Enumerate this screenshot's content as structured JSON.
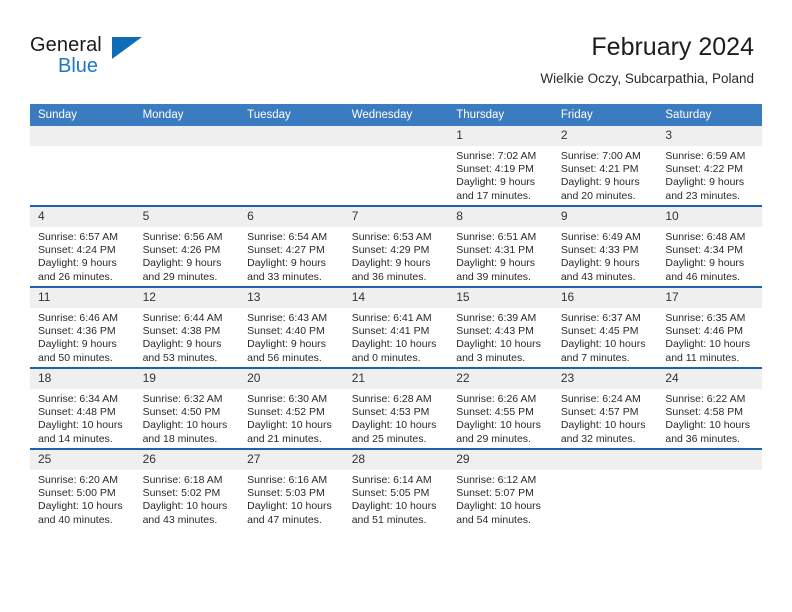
{
  "brand": {
    "name_top": "General",
    "name_bottom": "Blue",
    "accent_color": "#2077c4",
    "triangle_color": "#0d6cb5"
  },
  "header": {
    "title": "February 2024",
    "subtitle": "Wielkie Oczy, Subcarpathia, Poland"
  },
  "theme": {
    "header_bg": "#3b7cc1",
    "header_text": "#ffffff",
    "row_divider": "#1c63a8",
    "daynum_bg": "#efefef",
    "body_text": "#2a2a2a"
  },
  "calendar": {
    "weekday_headers": [
      "Sunday",
      "Monday",
      "Tuesday",
      "Wednesday",
      "Thursday",
      "Friday",
      "Saturday"
    ],
    "weeks": [
      [
        {
          "day": "",
          "empty": true
        },
        {
          "day": "",
          "empty": true
        },
        {
          "day": "",
          "empty": true
        },
        {
          "day": "",
          "empty": true
        },
        {
          "day": "1",
          "sunrise": "Sunrise: 7:02 AM",
          "sunset": "Sunset: 4:19 PM",
          "daylight_line1": "Daylight: 9 hours",
          "daylight_line2": "and 17 minutes."
        },
        {
          "day": "2",
          "sunrise": "Sunrise: 7:00 AM",
          "sunset": "Sunset: 4:21 PM",
          "daylight_line1": "Daylight: 9 hours",
          "daylight_line2": "and 20 minutes."
        },
        {
          "day": "3",
          "sunrise": "Sunrise: 6:59 AM",
          "sunset": "Sunset: 4:22 PM",
          "daylight_line1": "Daylight: 9 hours",
          "daylight_line2": "and 23 minutes."
        }
      ],
      [
        {
          "day": "4",
          "sunrise": "Sunrise: 6:57 AM",
          "sunset": "Sunset: 4:24 PM",
          "daylight_line1": "Daylight: 9 hours",
          "daylight_line2": "and 26 minutes."
        },
        {
          "day": "5",
          "sunrise": "Sunrise: 6:56 AM",
          "sunset": "Sunset: 4:26 PM",
          "daylight_line1": "Daylight: 9 hours",
          "daylight_line2": "and 29 minutes."
        },
        {
          "day": "6",
          "sunrise": "Sunrise: 6:54 AM",
          "sunset": "Sunset: 4:27 PM",
          "daylight_line1": "Daylight: 9 hours",
          "daylight_line2": "and 33 minutes."
        },
        {
          "day": "7",
          "sunrise": "Sunrise: 6:53 AM",
          "sunset": "Sunset: 4:29 PM",
          "daylight_line1": "Daylight: 9 hours",
          "daylight_line2": "and 36 minutes."
        },
        {
          "day": "8",
          "sunrise": "Sunrise: 6:51 AM",
          "sunset": "Sunset: 4:31 PM",
          "daylight_line1": "Daylight: 9 hours",
          "daylight_line2": "and 39 minutes."
        },
        {
          "day": "9",
          "sunrise": "Sunrise: 6:49 AM",
          "sunset": "Sunset: 4:33 PM",
          "daylight_line1": "Daylight: 9 hours",
          "daylight_line2": "and 43 minutes."
        },
        {
          "day": "10",
          "sunrise": "Sunrise: 6:48 AM",
          "sunset": "Sunset: 4:34 PM",
          "daylight_line1": "Daylight: 9 hours",
          "daylight_line2": "and 46 minutes."
        }
      ],
      [
        {
          "day": "11",
          "sunrise": "Sunrise: 6:46 AM",
          "sunset": "Sunset: 4:36 PM",
          "daylight_line1": "Daylight: 9 hours",
          "daylight_line2": "and 50 minutes."
        },
        {
          "day": "12",
          "sunrise": "Sunrise: 6:44 AM",
          "sunset": "Sunset: 4:38 PM",
          "daylight_line1": "Daylight: 9 hours",
          "daylight_line2": "and 53 minutes."
        },
        {
          "day": "13",
          "sunrise": "Sunrise: 6:43 AM",
          "sunset": "Sunset: 4:40 PM",
          "daylight_line1": "Daylight: 9 hours",
          "daylight_line2": "and 56 minutes."
        },
        {
          "day": "14",
          "sunrise": "Sunrise: 6:41 AM",
          "sunset": "Sunset: 4:41 PM",
          "daylight_line1": "Daylight: 10 hours",
          "daylight_line2": "and 0 minutes."
        },
        {
          "day": "15",
          "sunrise": "Sunrise: 6:39 AM",
          "sunset": "Sunset: 4:43 PM",
          "daylight_line1": "Daylight: 10 hours",
          "daylight_line2": "and 3 minutes."
        },
        {
          "day": "16",
          "sunrise": "Sunrise: 6:37 AM",
          "sunset": "Sunset: 4:45 PM",
          "daylight_line1": "Daylight: 10 hours",
          "daylight_line2": "and 7 minutes."
        },
        {
          "day": "17",
          "sunrise": "Sunrise: 6:35 AM",
          "sunset": "Sunset: 4:46 PM",
          "daylight_line1": "Daylight: 10 hours",
          "daylight_line2": "and 11 minutes."
        }
      ],
      [
        {
          "day": "18",
          "sunrise": "Sunrise: 6:34 AM",
          "sunset": "Sunset: 4:48 PM",
          "daylight_line1": "Daylight: 10 hours",
          "daylight_line2": "and 14 minutes."
        },
        {
          "day": "19",
          "sunrise": "Sunrise: 6:32 AM",
          "sunset": "Sunset: 4:50 PM",
          "daylight_line1": "Daylight: 10 hours",
          "daylight_line2": "and 18 minutes."
        },
        {
          "day": "20",
          "sunrise": "Sunrise: 6:30 AM",
          "sunset": "Sunset: 4:52 PM",
          "daylight_line1": "Daylight: 10 hours",
          "daylight_line2": "and 21 minutes."
        },
        {
          "day": "21",
          "sunrise": "Sunrise: 6:28 AM",
          "sunset": "Sunset: 4:53 PM",
          "daylight_line1": "Daylight: 10 hours",
          "daylight_line2": "and 25 minutes."
        },
        {
          "day": "22",
          "sunrise": "Sunrise: 6:26 AM",
          "sunset": "Sunset: 4:55 PM",
          "daylight_line1": "Daylight: 10 hours",
          "daylight_line2": "and 29 minutes."
        },
        {
          "day": "23",
          "sunrise": "Sunrise: 6:24 AM",
          "sunset": "Sunset: 4:57 PM",
          "daylight_line1": "Daylight: 10 hours",
          "daylight_line2": "and 32 minutes."
        },
        {
          "day": "24",
          "sunrise": "Sunrise: 6:22 AM",
          "sunset": "Sunset: 4:58 PM",
          "daylight_line1": "Daylight: 10 hours",
          "daylight_line2": "and 36 minutes."
        }
      ],
      [
        {
          "day": "25",
          "sunrise": "Sunrise: 6:20 AM",
          "sunset": "Sunset: 5:00 PM",
          "daylight_line1": "Daylight: 10 hours",
          "daylight_line2": "and 40 minutes."
        },
        {
          "day": "26",
          "sunrise": "Sunrise: 6:18 AM",
          "sunset": "Sunset: 5:02 PM",
          "daylight_line1": "Daylight: 10 hours",
          "daylight_line2": "and 43 minutes."
        },
        {
          "day": "27",
          "sunrise": "Sunrise: 6:16 AM",
          "sunset": "Sunset: 5:03 PM",
          "daylight_line1": "Daylight: 10 hours",
          "daylight_line2": "and 47 minutes."
        },
        {
          "day": "28",
          "sunrise": "Sunrise: 6:14 AM",
          "sunset": "Sunset: 5:05 PM",
          "daylight_line1": "Daylight: 10 hours",
          "daylight_line2": "and 51 minutes."
        },
        {
          "day": "29",
          "sunrise": "Sunrise: 6:12 AM",
          "sunset": "Sunset: 5:07 PM",
          "daylight_line1": "Daylight: 10 hours",
          "daylight_line2": "and 54 minutes."
        },
        {
          "day": "",
          "empty": true
        },
        {
          "day": "",
          "empty": true
        }
      ]
    ]
  }
}
